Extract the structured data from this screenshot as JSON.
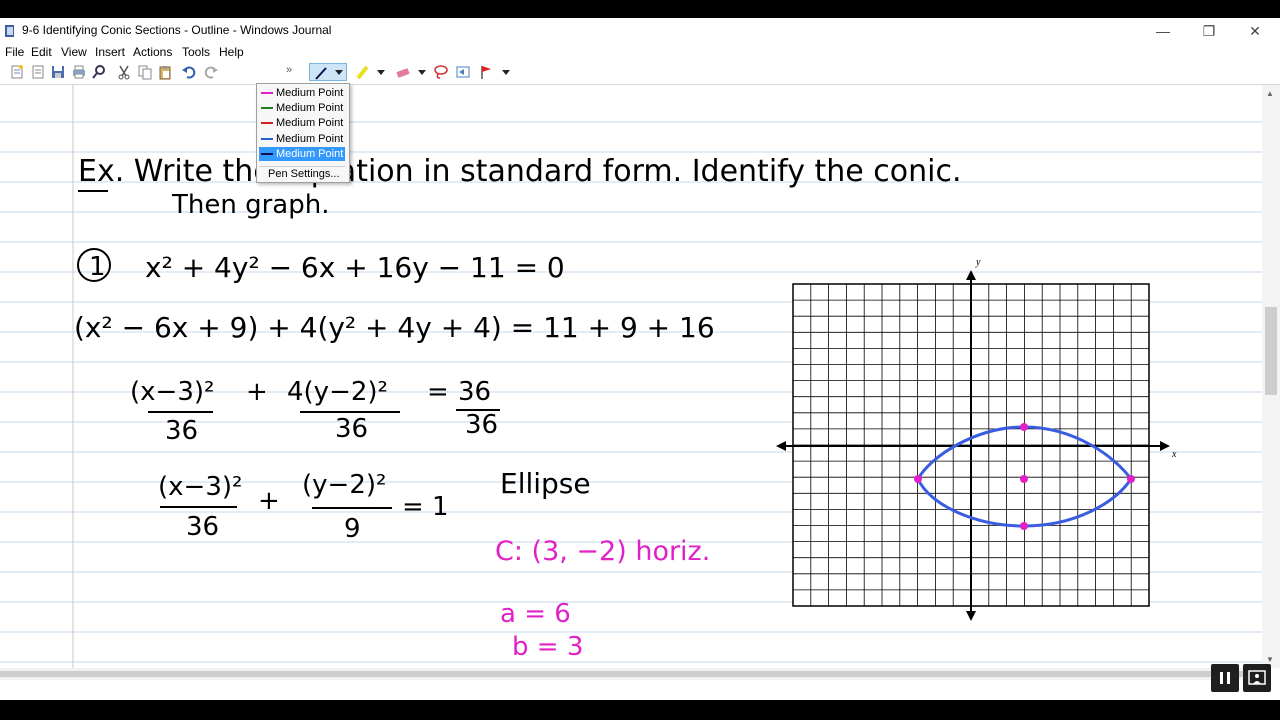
{
  "window": {
    "title": "9-6 Identifying Conic Sections - Outline - Windows Journal",
    "controls": {
      "minimize": "—",
      "restore": "❐",
      "close": "✕"
    }
  },
  "menu": [
    "File",
    "Edit",
    "View",
    "Insert",
    "Actions",
    "Tools",
    "Help"
  ],
  "toolbar": {
    "overflow": "»",
    "icons": [
      "new-note-icon",
      "template-icon",
      "save-icon",
      "print-icon",
      "find-icon",
      "cut-icon",
      "copy-icon",
      "paste-icon",
      "undo-icon",
      "redo-icon",
      "pen-icon",
      "highlighter-icon",
      "eraser-icon",
      "lasso-icon",
      "insert-space-icon",
      "flag-icon"
    ]
  },
  "pen_dropdown": {
    "items": [
      {
        "label": "Medium Point",
        "color": "#e020c8"
      },
      {
        "label": "Medium Point",
        "color": "#208020"
      },
      {
        "label": "Medium Point",
        "color": "#d02020"
      },
      {
        "label": "Medium Point",
        "color": "#2060d0"
      },
      {
        "label": "Medium Point",
        "color": "#101050"
      }
    ],
    "selected_index": 4,
    "settings_label": "Pen Settings..."
  },
  "note": {
    "heading": "Ex. Write the equation in standard form. Identify the conic.",
    "heading_line2": "Then graph.",
    "problem_number": "1",
    "eq1": "x² + 4y² − 6x + 16y − 11 = 0",
    "eq2": "(x² − 6x + 9) + 4(y² + 4y + 4) = 11 + 9 + 16",
    "eq3_num": [
      "(x−3)²",
      "+",
      "4(y−2)²",
      "=",
      "36"
    ],
    "eq3_den": [
      "36",
      "36",
      "36"
    ],
    "eq4_num": [
      "(x−3)²",
      "+",
      "(y−2)²",
      "= 1"
    ],
    "eq4_den": [
      "36",
      "9"
    ],
    "conic": "Ellipse",
    "center_note": "C: (3, −2)   horiz.",
    "a_value": "a = 6",
    "b_value": "b = 3"
  },
  "graph": {
    "x_label": "x",
    "y_label": "y",
    "ink_color": "#3a5de0",
    "point_color": "#e020c8"
  },
  "colors": {
    "ink": "#000000",
    "magenta": "#e020c8",
    "rule": "#c6d8ee",
    "margin": "#c8c8c8"
  }
}
